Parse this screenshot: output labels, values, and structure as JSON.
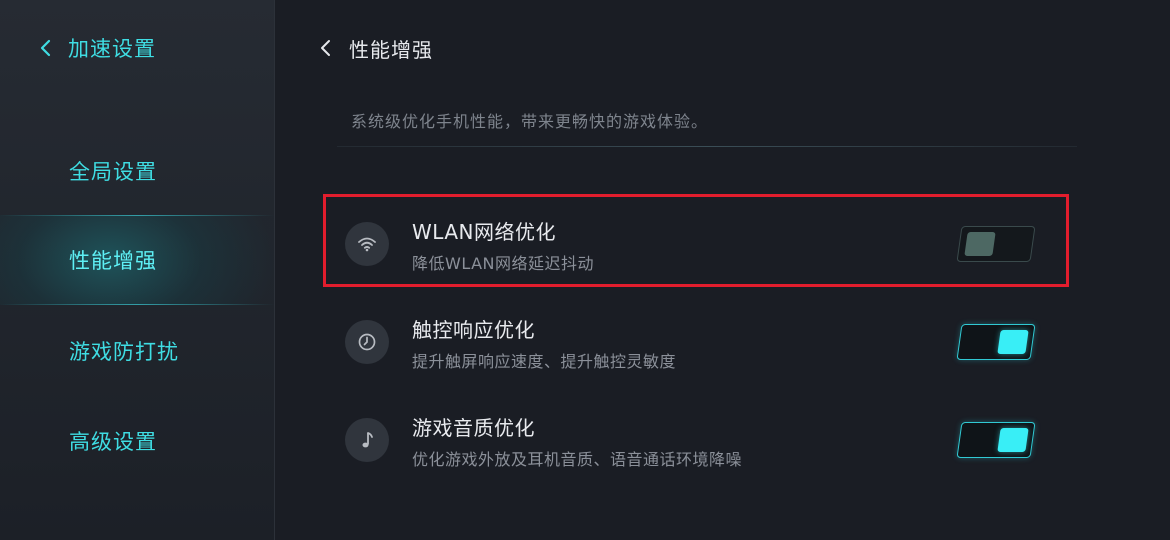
{
  "sidebar": {
    "title": "加速设置",
    "items": [
      {
        "label": "全局设置",
        "active": false
      },
      {
        "label": "性能增强",
        "active": true
      },
      {
        "label": "游戏防打扰",
        "active": false
      },
      {
        "label": "高级设置",
        "active": false
      }
    ]
  },
  "main": {
    "title": "性能增强",
    "description": "系统级优化手机性能，带来更畅快的游戏体验。",
    "settings": [
      {
        "icon": "wifi-icon",
        "title": "WLAN网络优化",
        "subtitle": "降低WLAN网络延迟抖动",
        "enabled": false,
        "highlighted": true
      },
      {
        "icon": "clock-icon",
        "title": "触控响应优化",
        "subtitle": "提升触屏响应速度、提升触控灵敏度",
        "enabled": true
      },
      {
        "icon": "music-note-icon",
        "title": "游戏音质优化",
        "subtitle": "优化游戏外放及耳机音质、语音通话环境降噪",
        "enabled": true
      }
    ]
  },
  "colors": {
    "accent": "#3fdde3",
    "toggle_on": "#39eef6",
    "highlight_box": "#e21d2d"
  }
}
